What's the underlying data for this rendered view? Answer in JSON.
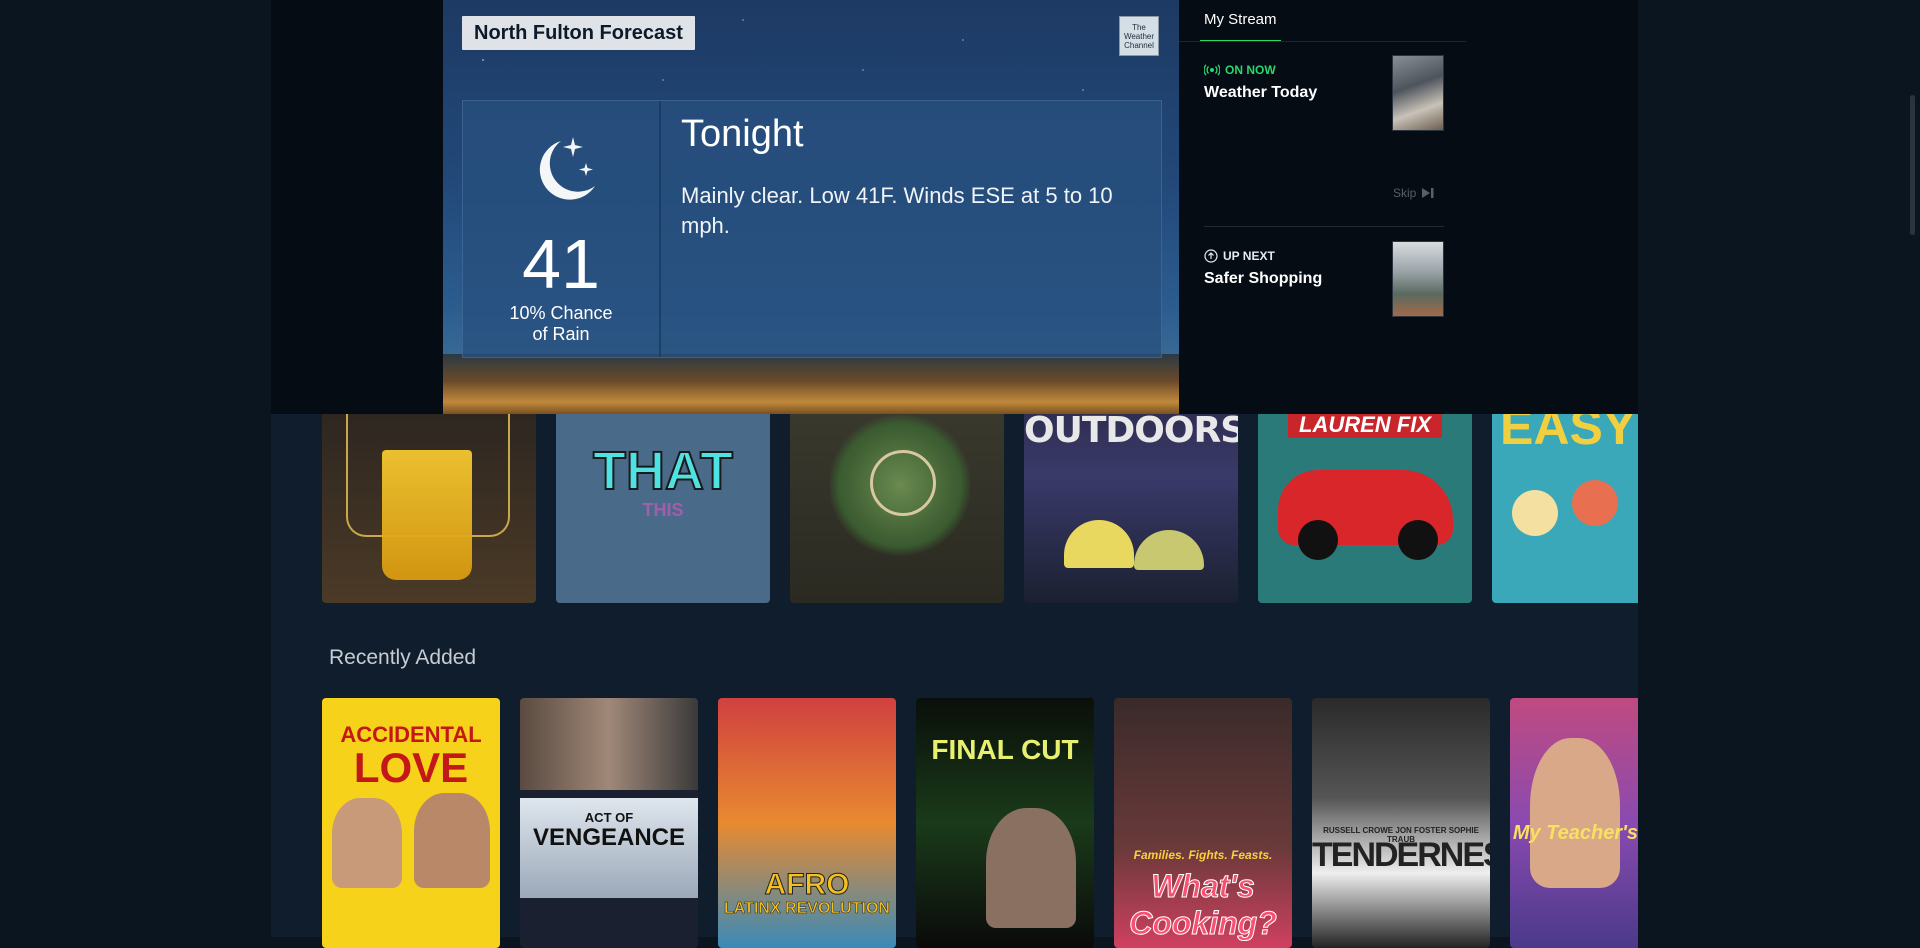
{
  "player": {
    "forecast_title": "North Fulton Forecast",
    "logo_text": "The Weather Channel",
    "period": "Tonight",
    "temperature": "41",
    "rain_line1": "10% Chance",
    "rain_line2": "of Rain",
    "description": "Mainly clear. Low 41F. Winds ESE at 5 to 10 mph."
  },
  "stream": {
    "tab_label": "My Stream",
    "on_now": {
      "status": "ON NOW",
      "title": "Weather Today",
      "status_color": "#2bd66a"
    },
    "skip_label": "Skip",
    "up_next": {
      "status": "UP NEXT",
      "title": "Safer Shopping"
    }
  },
  "row_tiles": [
    {
      "name": "cocktail",
      "text": ""
    },
    {
      "name": "this-and-that",
      "text": "THAT"
    },
    {
      "name": "holiday-wreath",
      "text": ""
    },
    {
      "name": "great-outdoors",
      "text": "OUTDOORS"
    },
    {
      "name": "lauren-fix",
      "text": "LAUREN FIX"
    },
    {
      "name": "easy",
      "text": "EASY"
    }
  ],
  "recently_added": {
    "title": "Recently Added",
    "posters": [
      {
        "name": "accidental-love",
        "line1": "ACCIDENTAL",
        "line2": "LOVE"
      },
      {
        "name": "act-of-vengeance",
        "line1": "ACT OF",
        "line2": "VENGEANCE"
      },
      {
        "name": "afro-latinx",
        "line1": "AFRO",
        "line2": "LATINX REVOLUTION"
      },
      {
        "name": "the-final-cut",
        "line1": "FINAL CUT",
        "line2": ""
      },
      {
        "name": "whats-cooking",
        "line1": "Families. Fights. Feasts.",
        "line2": "What's Cooking?"
      },
      {
        "name": "tenderness",
        "line1": "RUSSELL CROWE  JON FOSTER  SOPHIE TRAUB",
        "line2": "TENDERNESS"
      },
      {
        "name": "my-teachers",
        "line1": "My Teacher's",
        "line2": ""
      }
    ]
  }
}
